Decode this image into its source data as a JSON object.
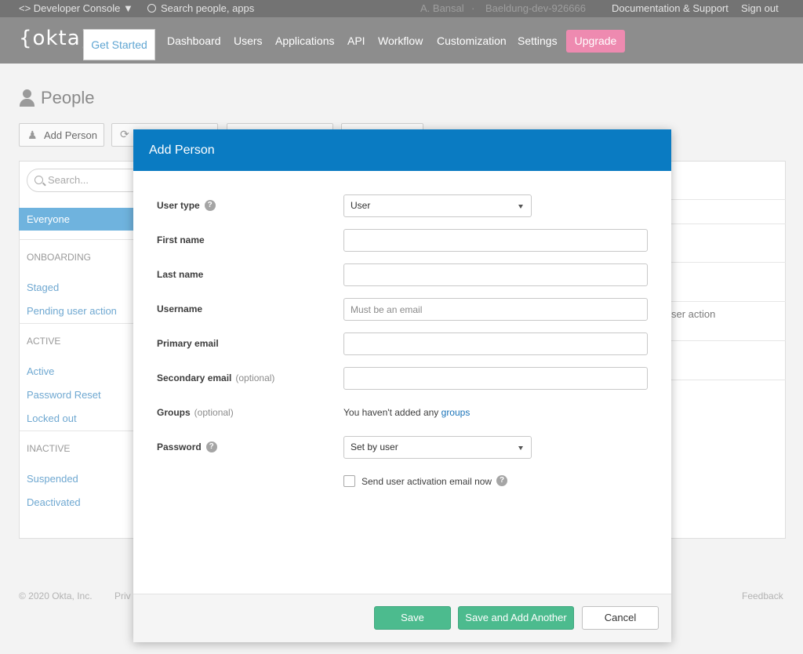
{
  "topbar": {
    "console": "<> Developer Console ▼",
    "search_placeholder": "Search people, apps",
    "user": "A. Bansal",
    "separator": "·",
    "org": "Baeldung-dev-926666",
    "docs": "Documentation & Support",
    "signout": "Sign out"
  },
  "nav": {
    "logo": "{okta}",
    "get_started": "Get Started",
    "links": [
      "Dashboard",
      "Users",
      "Applications",
      "API",
      "Workflow",
      "Customization",
      "Settings"
    ],
    "upgrade": "Upgrade"
  },
  "page": {
    "title": "People",
    "add_person": "Add Person",
    "search_placeholder": "Search...",
    "sidebar": {
      "everyone": "Everyone",
      "onboarding": "ONBOARDING",
      "staged": "Staged",
      "pending": "Pending user action",
      "active_h": "ACTIVE",
      "active": "Active",
      "password_reset": "Password Reset",
      "locked": "Locked out",
      "inactive_h": "INACTIVE",
      "suspended": "Suspended",
      "deactivated": "Deactivated"
    },
    "bg_row_text": "ser action"
  },
  "footer": {
    "copyright": "© 2020 Okta, Inc.",
    "privacy": "Priv",
    "feedback": "Feedback"
  },
  "modal": {
    "title": "Add Person",
    "user_type_label": "User type",
    "user_type_value": "User",
    "first_name_label": "First name",
    "last_name_label": "Last name",
    "username_label": "Username",
    "username_placeholder": "Must be an email",
    "primary_email_label": "Primary email",
    "secondary_email_label": "Secondary email",
    "optional": "(optional)",
    "groups_label": "Groups",
    "groups_text": "You haven't added any",
    "groups_link": "groups",
    "password_label": "Password",
    "password_value": "Set by user",
    "activation_label": "Send user activation email now",
    "help_glyph": "?",
    "save": "Save",
    "save_add": "Save and Add Another",
    "cancel": "Cancel"
  }
}
